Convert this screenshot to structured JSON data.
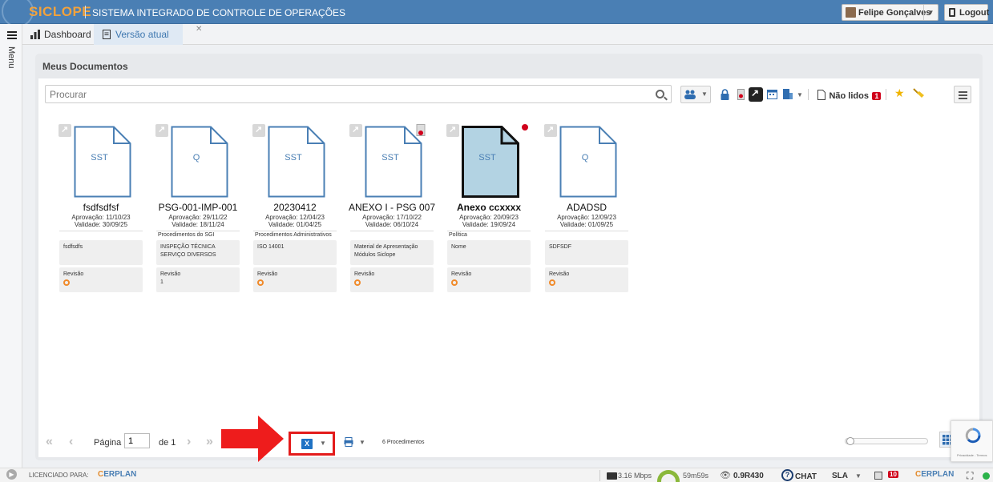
{
  "app": {
    "brand": "SICLOPE",
    "system_title": "SISTEMA INTEGRADO DE CONTROLE DE OPERAÇÕES",
    "user_name": "Felipe Gonçalves",
    "logout_label": "Logout",
    "accent_color": "#4a7fb4"
  },
  "menu": {
    "label": "Menu"
  },
  "tabs": [
    {
      "label": "Dashboard",
      "icon": "bar-chart-icon"
    },
    {
      "label": "Versão atual",
      "icon": "document-icon",
      "active": true
    }
  ],
  "panel": {
    "title": "Meus Documentos"
  },
  "search": {
    "placeholder": "Procurar",
    "value": ""
  },
  "toolbar": {
    "unread_label": "Não lidos",
    "unread_count": "1"
  },
  "documents": [
    {
      "type_code": "SST",
      "name": "fsdfsdfsf",
      "approval": "Aprovação: 11/10/23",
      "validity": "Validade: 30/09/25",
      "category": "",
      "description": "fsdfsdfs",
      "revision_label": "Revisão",
      "revision_value": ""
    },
    {
      "type_code": "Q",
      "name": "PSG-001-IMP-001",
      "approval": "Aprovação: 29/11/22",
      "validity": "Validade: 18/11/24",
      "category": "Procedimentos do SGI",
      "description": "INSPEÇÃO TÉCNICA SERVIÇO DIVERSOS",
      "revision_label": "Revisão",
      "revision_value": "1"
    },
    {
      "type_code": "SST",
      "name": "20230412",
      "approval": "Aprovação: 12/04/23",
      "validity": "Validade: 01/04/25",
      "category": "Procedimentos Administrativos",
      "description": "ISO 14001",
      "revision_label": "Revisão",
      "revision_value": ""
    },
    {
      "type_code": "SST",
      "name": "ANEXO I - PSG 007",
      "approval": "Aprovação: 17/10/22",
      "validity": "Validade: 06/10/24",
      "category": "",
      "description": "Material de Apresentação Módulos Siclope",
      "revision_label": "Revisão",
      "revision_value": ""
    },
    {
      "type_code": "SST",
      "name": "Anexo ccxxxx",
      "approval": "Aprovação: 20/09/23",
      "validity": "Validade: 19/09/24",
      "category": "Política",
      "description": "Nome",
      "revision_label": "Revisão",
      "revision_value": ""
    },
    {
      "type_code": "Q",
      "name": "ADADSD",
      "approval": "Aprovação: 12/09/23",
      "validity": "Validade: 01/09/25",
      "category": "",
      "description": "SDFSDF",
      "revision_label": "Revisão",
      "revision_value": ""
    }
  ],
  "pager": {
    "page_label": "Página",
    "page_value": "1",
    "of_label": "de 1",
    "count_label": "6 Procedimentos"
  },
  "statusbar": {
    "licensed_label": "LICENCIADO PARA:",
    "license_brand": "ERPLAN",
    "speed": "3.16 Mbps",
    "timer": "59m59s",
    "version": "0.9R430",
    "chat_label": "CHAT",
    "sla_label": "SLA",
    "notif_count": "10",
    "footer_brand": "ERPLAN"
  },
  "captcha": {
    "text": "Privacidade - Termos"
  }
}
